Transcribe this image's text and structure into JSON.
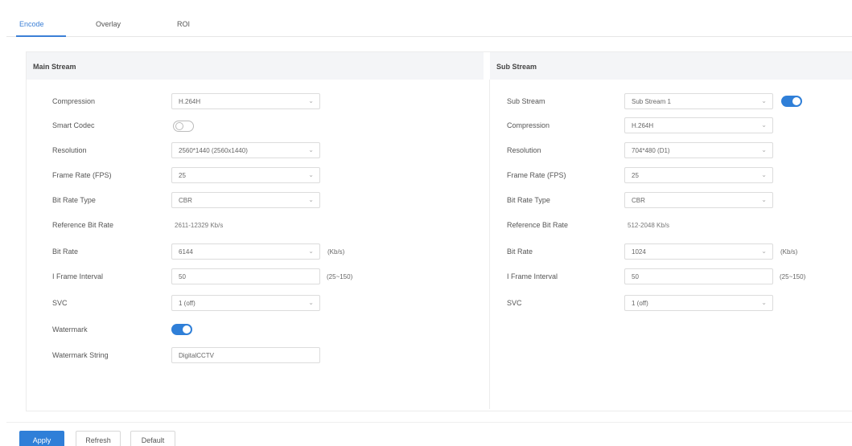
{
  "tabs": [
    {
      "label": "Encode"
    },
    {
      "label": "Overlay"
    },
    {
      "label": "ROI"
    }
  ],
  "main_stream": {
    "title": "Main Stream",
    "compression": {
      "label": "Compression",
      "value": "H.264H"
    },
    "smart_codec": {
      "label": "Smart Codec",
      "enabled": false
    },
    "resolution": {
      "label": "Resolution",
      "value": "2560*1440 (2560x1440)"
    },
    "frame_rate": {
      "label": "Frame Rate (FPS)",
      "value": "25"
    },
    "bit_rate_type": {
      "label": "Bit Rate Type",
      "value": "CBR"
    },
    "reference_bit_rate": {
      "label": "Reference Bit Rate",
      "value": "2611-12329 Kb/s"
    },
    "bit_rate": {
      "label": "Bit Rate",
      "value": "6144",
      "unit": "(Kb/s)"
    },
    "i_frame_interval": {
      "label": "I Frame Interval",
      "value": "50",
      "range": "(25~150)"
    },
    "svc": {
      "label": "SVC",
      "value": "1 (off)"
    },
    "watermark": {
      "label": "Watermark",
      "enabled": true
    },
    "watermark_string": {
      "label": "Watermark String",
      "value": "DigitalCCTV"
    }
  },
  "sub_stream": {
    "title": "Sub Stream",
    "sub_stream": {
      "label": "Sub Stream",
      "value": "Sub Stream 1",
      "enabled": true
    },
    "compression": {
      "label": "Compression",
      "value": "H.264H"
    },
    "resolution": {
      "label": "Resolution",
      "value": "704*480 (D1)"
    },
    "frame_rate": {
      "label": "Frame Rate (FPS)",
      "value": "25"
    },
    "bit_rate_type": {
      "label": "Bit Rate Type",
      "value": "CBR"
    },
    "reference_bit_rate": {
      "label": "Reference Bit Rate",
      "value": "512-2048 Kb/s"
    },
    "bit_rate": {
      "label": "Bit Rate",
      "value": "1024",
      "unit": "(Kb/s)"
    },
    "i_frame_interval": {
      "label": "I Frame Interval",
      "value": "50",
      "range": "(25~150)"
    },
    "svc": {
      "label": "SVC",
      "value": "1 (off)"
    }
  },
  "buttons": {
    "apply": "Apply",
    "refresh": "Refresh",
    "default": "Default"
  },
  "icons": {
    "chevron": "chevron-down-icon"
  },
  "colors": {
    "accent": "#2f7fd8"
  }
}
